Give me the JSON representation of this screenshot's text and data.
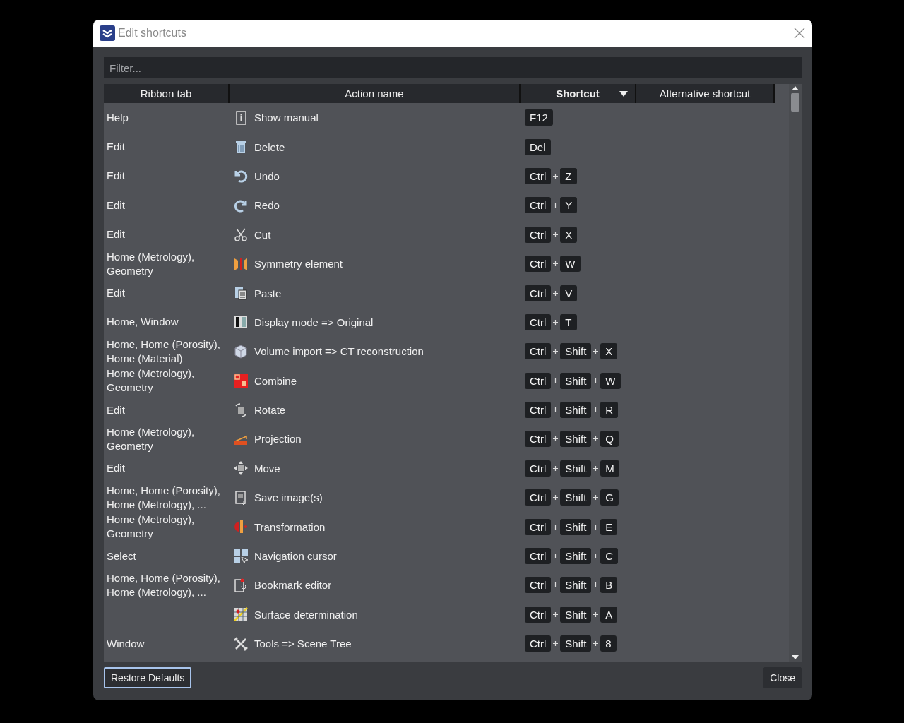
{
  "window": {
    "title": "Edit shortcuts"
  },
  "filter": {
    "placeholder": "Filter..."
  },
  "table": {
    "columns": [
      {
        "label": "Ribbon tab",
        "sorted": false
      },
      {
        "label": "Action name",
        "sorted": false
      },
      {
        "label": "Shortcut",
        "sorted": true
      },
      {
        "label": "Alternative shortcut",
        "sorted": false
      }
    ],
    "rows": [
      {
        "ribbon_tab": "Help",
        "action": "Show manual",
        "shortcut": [
          "F12"
        ]
      },
      {
        "ribbon_tab": "Edit",
        "action": "Delete",
        "shortcut": [
          "Del"
        ]
      },
      {
        "ribbon_tab": "Edit",
        "action": "Undo",
        "shortcut": [
          "Ctrl",
          "Z"
        ]
      },
      {
        "ribbon_tab": "Edit",
        "action": "Redo",
        "shortcut": [
          "Ctrl",
          "Y"
        ]
      },
      {
        "ribbon_tab": "Edit",
        "action": "Cut",
        "shortcut": [
          "Ctrl",
          "X"
        ]
      },
      {
        "ribbon_tab": "Home (Metrology), Geometry",
        "action": "Symmetry element",
        "shortcut": [
          "Ctrl",
          "W"
        ]
      },
      {
        "ribbon_tab": "Edit",
        "action": "Paste",
        "shortcut": [
          "Ctrl",
          "V"
        ]
      },
      {
        "ribbon_tab": "Home, Window",
        "action": "Display mode => Original",
        "shortcut": [
          "Ctrl",
          "T"
        ]
      },
      {
        "ribbon_tab": "Home, Home (Porosity), Home (Material)",
        "action": "Volume import => CT reconstruction",
        "shortcut": [
          "Ctrl",
          "Shift",
          "X"
        ]
      },
      {
        "ribbon_tab": "Home (Metrology), Geometry",
        "action": "Combine",
        "shortcut": [
          "Ctrl",
          "Shift",
          "W"
        ]
      },
      {
        "ribbon_tab": "Edit",
        "action": "Rotate",
        "shortcut": [
          "Ctrl",
          "Shift",
          "R"
        ]
      },
      {
        "ribbon_tab": "Home (Metrology), Geometry",
        "action": "Projection",
        "shortcut": [
          "Ctrl",
          "Shift",
          "Q"
        ]
      },
      {
        "ribbon_tab": "Edit",
        "action": "Move",
        "shortcut": [
          "Ctrl",
          "Shift",
          "M"
        ]
      },
      {
        "ribbon_tab": "Home, Home (Porosity), Home (Metrology), ...",
        "action": "Save image(s)",
        "shortcut": [
          "Ctrl",
          "Shift",
          "G"
        ]
      },
      {
        "ribbon_tab": "Home (Metrology), Geometry",
        "action": "Transformation",
        "shortcut": [
          "Ctrl",
          "Shift",
          "E"
        ]
      },
      {
        "ribbon_tab": "Select",
        "action": "Navigation cursor",
        "shortcut": [
          "Ctrl",
          "Shift",
          "C"
        ]
      },
      {
        "ribbon_tab": "Home, Home (Porosity), Home (Metrology), ...",
        "action": "Bookmark editor",
        "shortcut": [
          "Ctrl",
          "Shift",
          "B"
        ]
      },
      {
        "action": "Surface determination",
        "shortcut": [
          "Ctrl",
          "Shift",
          "A"
        ]
      },
      {
        "ribbon_tab": "Window",
        "action": "Tools => Scene Tree",
        "shortcut": [
          "Ctrl",
          "Shift",
          "8"
        ]
      }
    ]
  },
  "buttons": {
    "restore": {
      "label": "Restore Defaults",
      "focused": true
    },
    "close": {
      "label": "Close",
      "focused": false
    }
  }
}
